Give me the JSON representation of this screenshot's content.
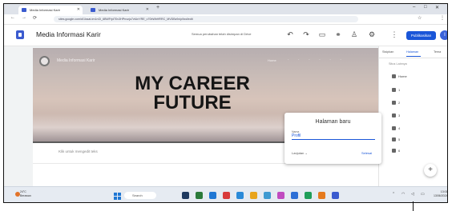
{
  "browser": {
    "tabs": [
      {
        "label": "Media Informasi Karir",
        "active": true,
        "favicon_color": "#3b5bcf"
      },
      {
        "label": "Media Informasi Karir",
        "active": false,
        "favicon_color": "#3b5bcf"
      }
    ],
    "new_tab_glyph": "+",
    "window_controls": [
      "–",
      "□",
      "✕"
    ],
    "nav_glyphs": [
      "←",
      "→",
      "⟳"
    ],
    "url": "sites.google.com/d/1lcsat-tm1nGl_6BWFrjdT0v3HPrrzzjo7vtUnYRE_v70bWbHRRC_MVDBz9x/p/fwd/edit",
    "right_icons": [
      "☆",
      "⋮"
    ]
  },
  "toolbar": {
    "site_title": "Media Informasi Karir",
    "publish_status": "Semua perubahan telah disimpan di Drive",
    "icons": [
      "undo-icon",
      "redo-icon",
      "preview-icon",
      "link-icon",
      "person-add-icon",
      "settings-icon",
      "more-icon"
    ],
    "publish_label": "Publikasikan",
    "avatar_initial": "I"
  },
  "hero": {
    "site_name": "Media Informasi Karir",
    "nav_label": "Home",
    "title": "MY CAREER FUTURE"
  },
  "body": {
    "placeholder_text": "Klik untuk mengedit teks"
  },
  "dialog": {
    "title": "Halaman baru",
    "field_label": "Nama",
    "field_value": "Profil",
    "secondary_link": "Lanjutan ⌄",
    "confirm_label": "Selesai"
  },
  "right_panel": {
    "tabs": [
      {
        "label": "Sisipkan",
        "active": false
      },
      {
        "label": "Halaman",
        "active": true
      },
      {
        "label": "Tema",
        "active": false
      }
    ],
    "section_heading": "Situs Lainnya",
    "items": [
      "Home",
      "1",
      "2",
      "3",
      "4",
      "5",
      "6"
    ],
    "fab_glyph": "+"
  },
  "taskbar": {
    "weather_temp": "24°C",
    "weather_desc": "Berawan",
    "search_label": "Search",
    "app_colors": [
      "#1f3a60",
      "#2b7a3a",
      "#1f77d4",
      "#d83b3b",
      "#2b8ad8",
      "#e8a41c",
      "#3f9ad1",
      "#c04bc0",
      "#2d6fd6",
      "#1f9e59",
      "#e57a1f",
      "#3b5bcf"
    ],
    "time": "13:01",
    "date": "13/06/2024"
  }
}
